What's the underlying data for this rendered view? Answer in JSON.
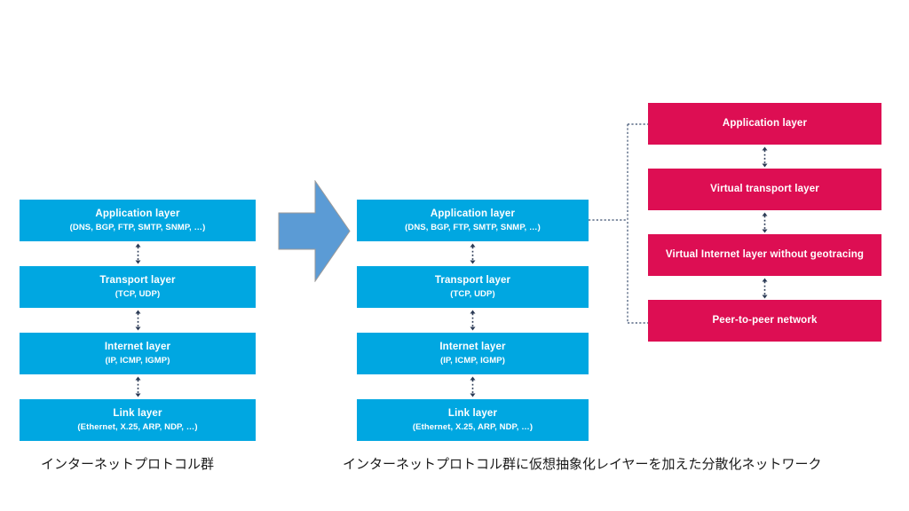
{
  "colors": {
    "blue": "#00a7e1",
    "red": "#dd0e53",
    "arrow_block": "#5b9bd5",
    "arrow_block_border": "#9a9a9a",
    "connector": "#5a6b86",
    "background": "#ffffff",
    "caption_text": "#1a1a1a"
  },
  "left_stack": {
    "caption": "インターネットプロトコル群",
    "layers": [
      {
        "title": "Application layer",
        "sub": "(DNS, BGP, FTP, SMTP, SNMP, …)"
      },
      {
        "title": "Transport layer",
        "sub": "(TCP, UDP)"
      },
      {
        "title": "Internet layer",
        "sub": "(IP, ICMP, IGMP)"
      },
      {
        "title": "Link layer",
        "sub": "(Ethernet, X.25, ARP, NDP, …)"
      }
    ]
  },
  "middle_stack": {
    "layers": [
      {
        "title": "Application layer",
        "sub": "(DNS, BGP, FTP, SMTP, SNMP, …)"
      },
      {
        "title": "Transport layer",
        "sub": "(TCP, UDP)"
      },
      {
        "title": "Internet layer",
        "sub": "(IP, ICMP, IGMP)"
      },
      {
        "title": "Link layer",
        "sub": "(Ethernet, X.25, ARP, NDP, …)"
      }
    ]
  },
  "right_stack": {
    "layers": [
      {
        "title": "Application layer",
        "sub": ""
      },
      {
        "title": "Virtual transport layer",
        "sub": ""
      },
      {
        "title": "Virtual Internet layer without geotracing",
        "sub": ""
      },
      {
        "title": "Peer-to-peer network",
        "sub": ""
      }
    ]
  },
  "right_caption": "インターネットプロトコル群に仮想抽象化レイヤーを加えた分散化ネットワーク",
  "icons": {
    "transform_arrow": "right-block-arrow-icon",
    "layer_link": "double-headed-dotted-arrow-icon",
    "bracket": "dotted-bracket-connector-icon"
  }
}
